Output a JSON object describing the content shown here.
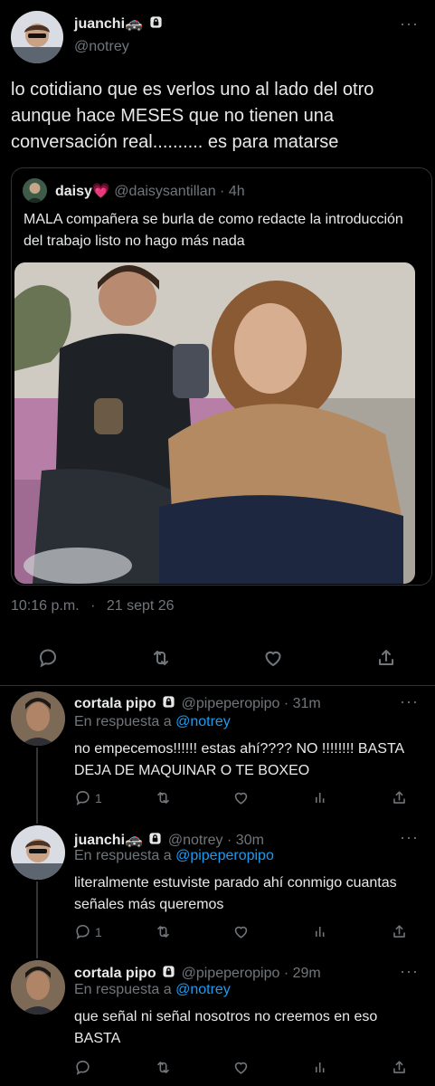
{
  "main_tweet": {
    "author_name": "juanchi🚓",
    "author_handle": "@notrey",
    "text": "lo cotidiano que es verlos uno al lado del otro aunque hace MESES que no tienen una conversación real.......... es para matarse",
    "timestamp": "10:16 p.m.",
    "separator": "·",
    "date": "21 sept 26",
    "quote": {
      "author_name": "daisy💗",
      "author_handle": "@daisysantillan",
      "separator": "·",
      "time": "4h",
      "text": "MALA compañera se burla de como redacte la introducción del trabajo listo no hago más nada"
    }
  },
  "replies": [
    {
      "author_name": "cortala pipo",
      "author_handle": "@pipeperopipo",
      "separator": "·",
      "time": "31m",
      "reply_label": "En respuesta a",
      "reply_to": "@notrey",
      "text": "no empecemos!!!!!! estas ahí???? NO !!!!!!!! BASTA DEJA DE MAQUINAR O TE BOXEO",
      "reply_count": "1"
    },
    {
      "author_name": "juanchi🚓",
      "author_handle": "@notrey",
      "separator": "·",
      "time": "30m",
      "reply_label": "En respuesta a",
      "reply_to": "@pipeperopipo",
      "text": "literalmente estuviste parado ahí conmigo cuantas señales más queremos",
      "reply_count": "1"
    },
    {
      "author_name": "cortala pipo",
      "author_handle": "@pipeperopipo",
      "separator": "·",
      "time": "29m",
      "reply_label": "En respuesta a",
      "reply_to": "@notrey",
      "text": "que señal ni señal nosotros no creemos en eso BASTA",
      "reply_count": ""
    }
  ],
  "icons": {
    "lock": "lock-icon",
    "more": "more-icon",
    "reply": "reply-icon",
    "retweet": "retweet-icon",
    "like": "heart-icon",
    "views": "views-icon",
    "share": "share-icon"
  },
  "colors": {
    "background": "#000000",
    "text": "#e7e9ea",
    "muted": "#71767b",
    "link": "#1d9bf0",
    "border": "#2f3336"
  }
}
